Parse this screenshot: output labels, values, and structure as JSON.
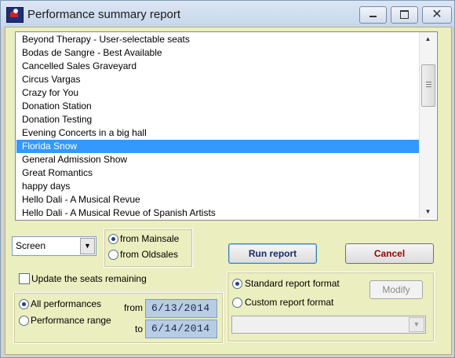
{
  "window": {
    "title": "Performance summary report",
    "close_glyph": "✕"
  },
  "performances": {
    "items": [
      "Beyond Therapy - User-selectable seats",
      "Bodas de Sangre - Best Available",
      "Cancelled Sales Graveyard",
      "Circus Vargas",
      "Crazy for You",
      "Donation Station",
      "Donation Testing",
      "Evening Concerts in a big hall",
      "Florida Snow",
      "General Admission Show",
      "Great Romantics",
      "happy days",
      "Hello Dali - A Musical Revue",
      "Hello Dali - A Musical Revue of Spanish Artists"
    ],
    "selected": "Florida Snow"
  },
  "output": {
    "selected": "Screen"
  },
  "source": {
    "mainsale": "from Mainsale",
    "oldsales": "from Oldsales",
    "selected": "mainsale"
  },
  "buttons": {
    "run": "Run report",
    "cancel": "Cancel",
    "modify": "Modify"
  },
  "update_seats": {
    "label": "Update the seats remaining",
    "checked": false
  },
  "range": {
    "all": "All performances",
    "range": "Performance range",
    "selected": "all",
    "from_label": "from",
    "to_label": "to",
    "from_date": "6/13/2014",
    "to_date": "6/14/2014"
  },
  "format": {
    "standard": "Standard report format",
    "custom": "Custom report format",
    "selected": "standard"
  },
  "colors": {
    "selection": "#3399ff",
    "client_bg": "#ebeebe",
    "cancel_text": "#a00000"
  },
  "icons": {
    "app": "performance-report-app-icon",
    "minimize": "minimize-icon",
    "maximize": "maximize-icon",
    "close": "close-icon"
  }
}
